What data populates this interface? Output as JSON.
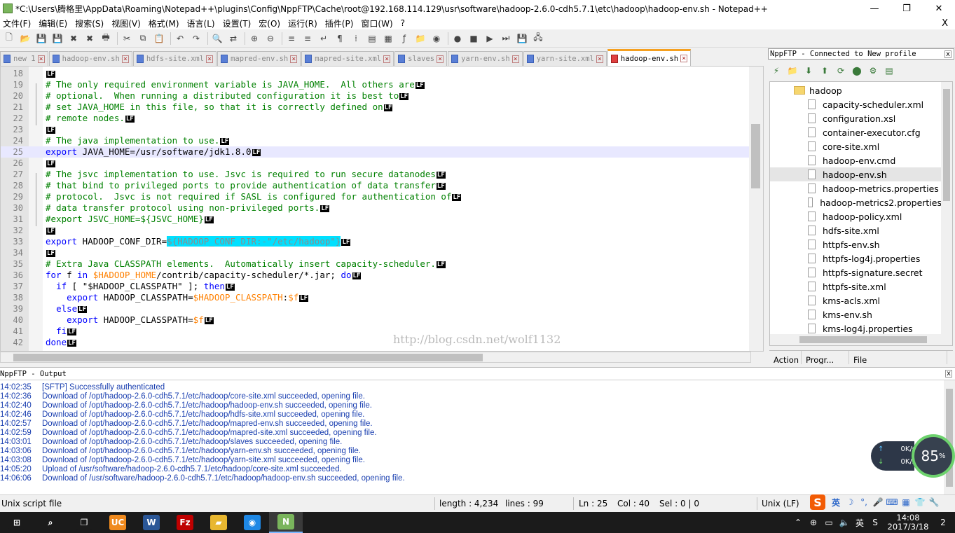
{
  "window": {
    "title": "*C:\\Users\\腾格里\\AppData\\Roaming\\Notepad++\\plugins\\Config\\NppFTP\\Cache\\root@192.168.114.129\\usr\\software\\hadoop-2.6.0-cdh5.7.1\\etc\\hadoop\\hadoop-env.sh - Notepad++",
    "minimize": "—",
    "maximize": "❐",
    "close": "✕"
  },
  "menu": {
    "items": [
      "文件(F)",
      "编辑(E)",
      "搜索(S)",
      "视图(V)",
      "格式(M)",
      "语言(L)",
      "设置(T)",
      "宏(O)",
      "运行(R)",
      "插件(P)",
      "窗口(W)",
      "?"
    ],
    "close": "X"
  },
  "toolbar": {
    "icons": [
      "new-file-icon",
      "open-file-icon",
      "save-icon",
      "save-all-icon",
      "close-icon",
      "close-all-icon",
      "print-icon",
      "cut-icon",
      "copy-icon",
      "paste-icon",
      "undo-icon",
      "redo-icon",
      "find-icon",
      "replace-icon",
      "zoom-in-icon",
      "zoom-out-icon",
      "sync-vertical-icon",
      "sync-horizontal-icon",
      "word-wrap-icon",
      "show-all-chars-icon",
      "indent-guide-icon",
      "udl-icon",
      "doc-map-icon",
      "function-list-icon",
      "folder-workspace-icon",
      "monitoring-icon",
      "record-macro-icon",
      "stop-macro-icon",
      "play-macro-icon",
      "run-macro-multiple-icon",
      "save-macro-icon",
      "nppftp-icon"
    ],
    "glyphs": [
      "🗋",
      "📂",
      "💾",
      "💾",
      "✖",
      "✖",
      "🖶",
      "✂",
      "⧉",
      "📋",
      "↶",
      "↷",
      "🔍",
      "⇄",
      "⊕",
      "⊖",
      "≡",
      "≡",
      "↵",
      "¶",
      "⁞",
      "▤",
      "▦",
      "ƒ",
      "📁",
      "◉",
      "●",
      "■",
      "▶",
      "⏭",
      "💾",
      "🖧"
    ]
  },
  "tabs": [
    {
      "label": "new 1",
      "active": false
    },
    {
      "label": "hadoop-env.sh",
      "active": false
    },
    {
      "label": "hdfs-site.xml",
      "active": false
    },
    {
      "label": "mapred-env.sh",
      "active": false
    },
    {
      "label": "mapred-site.xml",
      "active": false
    },
    {
      "label": "slaves",
      "active": false
    },
    {
      "label": "yarn-env.sh",
      "active": false
    },
    {
      "label": "yarn-site.xml",
      "active": false
    },
    {
      "label": "hadoop-env.sh",
      "active": true
    }
  ],
  "editor": {
    "eol_marker": "LF",
    "current_line": 25,
    "lines": [
      {
        "n": "18",
        "segs": []
      },
      {
        "n": "19",
        "segs": [
          {
            "t": "# The only required environment variable is JAVA_HOME.  All others are",
            "c": "cmt"
          }
        ]
      },
      {
        "n": "20",
        "segs": [
          {
            "t": "# optional.  When running a distributed configuration it is best to",
            "c": "cmt"
          }
        ]
      },
      {
        "n": "21",
        "segs": [
          {
            "t": "# set JAVA_HOME in this file, so that it is correctly defined on",
            "c": "cmt"
          }
        ]
      },
      {
        "n": "22",
        "segs": [
          {
            "t": "# remote nodes.",
            "c": "cmt"
          }
        ]
      },
      {
        "n": "23",
        "segs": []
      },
      {
        "n": "24",
        "segs": [
          {
            "t": "# The java implementation to use.",
            "c": "cmt"
          }
        ]
      },
      {
        "n": "25",
        "segs": [
          {
            "t": "export",
            "c": "kw"
          },
          {
            "t": " JAVA_HOME=/usr/software/jdk1.8.0",
            "c": ""
          }
        ]
      },
      {
        "n": "26",
        "segs": []
      },
      {
        "n": "27",
        "segs": [
          {
            "t": "# The jsvc implementation to use. Jsvc is required to run secure datanodes",
            "c": "cmt"
          }
        ]
      },
      {
        "n": "28",
        "segs": [
          {
            "t": "# that bind to privileged ports to provide authentication of data transfer",
            "c": "cmt"
          }
        ]
      },
      {
        "n": "29",
        "segs": [
          {
            "t": "# protocol.  Jsvc is not required if SASL is configured for authentication of",
            "c": "cmt"
          }
        ]
      },
      {
        "n": "30",
        "segs": [
          {
            "t": "# data transfer protocol using non-privileged ports.",
            "c": "cmt"
          }
        ]
      },
      {
        "n": "31",
        "segs": [
          {
            "t": "#export JSVC_HOME=${JSVC_HOME}",
            "c": "cmt"
          }
        ]
      },
      {
        "n": "32",
        "segs": []
      },
      {
        "n": "33",
        "segs": [
          {
            "t": "export",
            "c": "kw"
          },
          {
            "t": " HADOOP_CONF_DIR=",
            "c": ""
          },
          {
            "t": "${HADOOP_CONF_DIR:-\"/etc/hadoop\"}",
            "c": "hl"
          }
        ]
      },
      {
        "n": "34",
        "segs": []
      },
      {
        "n": "35",
        "segs": [
          {
            "t": "# Extra Java CLASSPATH elements.  Automatically insert capacity-scheduler.",
            "c": "cmt"
          }
        ]
      },
      {
        "n": "36",
        "segs": [
          {
            "t": "for",
            "c": "kw"
          },
          {
            "t": " f ",
            "c": ""
          },
          {
            "t": "in",
            "c": "kw"
          },
          {
            "t": " ",
            "c": ""
          },
          {
            "t": "$HADOOP_HOME",
            "c": "var"
          },
          {
            "t": "/contrib/capacity-scheduler/*.jar; ",
            "c": ""
          },
          {
            "t": "do",
            "c": "kw"
          }
        ]
      },
      {
        "n": "37",
        "segs": [
          {
            "t": "  ",
            "c": ""
          },
          {
            "t": "if",
            "c": "kw"
          },
          {
            "t": " [ \"$HADOOP_CLASSPATH\" ]; ",
            "c": ""
          },
          {
            "t": "then",
            "c": "kw"
          }
        ]
      },
      {
        "n": "38",
        "segs": [
          {
            "t": "    ",
            "c": ""
          },
          {
            "t": "export",
            "c": "kw"
          },
          {
            "t": " HADOOP_CLASSPATH=",
            "c": ""
          },
          {
            "t": "$HADOOP_CLASSPATH",
            "c": "var"
          },
          {
            "t": ":",
            "c": ""
          },
          {
            "t": "$f",
            "c": "var"
          }
        ]
      },
      {
        "n": "39",
        "segs": [
          {
            "t": "  ",
            "c": ""
          },
          {
            "t": "else",
            "c": "kw"
          }
        ]
      },
      {
        "n": "40",
        "segs": [
          {
            "t": "    ",
            "c": ""
          },
          {
            "t": "export",
            "c": "kw"
          },
          {
            "t": " HADOOP_CLASSPATH=",
            "c": ""
          },
          {
            "t": "$f",
            "c": "var"
          }
        ]
      },
      {
        "n": "41",
        "segs": [
          {
            "t": "  ",
            "c": ""
          },
          {
            "t": "fi",
            "c": "kw"
          }
        ]
      },
      {
        "n": "42",
        "segs": [
          {
            "t": "done",
            "c": "kw"
          }
        ]
      }
    ],
    "watermark": "http://blog.csdn.net/wolf1132"
  },
  "nppftp": {
    "title": "NppFTP - Connected to New profile",
    "close": "x",
    "toolbar_icons": [
      "connect-icon",
      "open-dir-icon",
      "download-icon",
      "upload-icon",
      "refresh-icon",
      "abort-icon",
      "settings-icon",
      "message-window-icon"
    ],
    "toolbar_glyphs": [
      "⚡",
      "📁",
      "⬇",
      "⬆",
      "⟳",
      "⬤",
      "⚙",
      "▤"
    ],
    "tree": [
      {
        "name": "hadoop",
        "type": "folder"
      },
      {
        "name": "capacity-scheduler.xml",
        "type": "file"
      },
      {
        "name": "configuration.xsl",
        "type": "file"
      },
      {
        "name": "container-executor.cfg",
        "type": "file"
      },
      {
        "name": "core-site.xml",
        "type": "file"
      },
      {
        "name": "hadoop-env.cmd",
        "type": "file"
      },
      {
        "name": "hadoop-env.sh",
        "type": "file",
        "selected": true
      },
      {
        "name": "hadoop-metrics.properties",
        "type": "file"
      },
      {
        "name": "hadoop-metrics2.properties",
        "type": "file"
      },
      {
        "name": "hadoop-policy.xml",
        "type": "file"
      },
      {
        "name": "hdfs-site.xml",
        "type": "file"
      },
      {
        "name": "httpfs-env.sh",
        "type": "file"
      },
      {
        "name": "httpfs-log4j.properties",
        "type": "file"
      },
      {
        "name": "httpfs-signature.secret",
        "type": "file"
      },
      {
        "name": "httpfs-site.xml",
        "type": "file"
      },
      {
        "name": "kms-acls.xml",
        "type": "file"
      },
      {
        "name": "kms-env.sh",
        "type": "file"
      },
      {
        "name": "kms-log4j.properties",
        "type": "file"
      }
    ],
    "columns": [
      "Action",
      "Progr...",
      "File"
    ]
  },
  "output": {
    "title": "NppFTP - Output",
    "close": "x",
    "lines": [
      {
        "time": "14:02:35",
        "msg": "[SFTP] Successfully authenticated"
      },
      {
        "time": "14:02:36",
        "msg": "Download of /opt/hadoop-2.6.0-cdh5.7.1/etc/hadoop/core-site.xml succeeded, opening file."
      },
      {
        "time": "14:02:40",
        "msg": "Download of /opt/hadoop-2.6.0-cdh5.7.1/etc/hadoop/hadoop-env.sh succeeded, opening file."
      },
      {
        "time": "14:02:46",
        "msg": "Download of /opt/hadoop-2.6.0-cdh5.7.1/etc/hadoop/hdfs-site.xml succeeded, opening file."
      },
      {
        "time": "14:02:57",
        "msg": "Download of /opt/hadoop-2.6.0-cdh5.7.1/etc/hadoop/mapred-env.sh succeeded, opening file."
      },
      {
        "time": "14:02:59",
        "msg": "Download of /opt/hadoop-2.6.0-cdh5.7.1/etc/hadoop/mapred-site.xml succeeded, opening file."
      },
      {
        "time": "14:03:01",
        "msg": "Download of /opt/hadoop-2.6.0-cdh5.7.1/etc/hadoop/slaves succeeded, opening file."
      },
      {
        "time": "14:03:06",
        "msg": "Download of /opt/hadoop-2.6.0-cdh5.7.1/etc/hadoop/yarn-env.sh succeeded, opening file."
      },
      {
        "time": "14:03:08",
        "msg": "Download of /opt/hadoop-2.6.0-cdh5.7.1/etc/hadoop/yarn-site.xml succeeded, opening file."
      },
      {
        "time": "14:05:20",
        "msg": "Upload of /usr/software/hadoop-2.6.0-cdh5.7.1/etc/hadoop/core-site.xml succeeded."
      },
      {
        "time": "14:06:06",
        "msg": "Download of /usr/software/hadoop-2.6.0-cdh5.7.1/etc/hadoop/hadoop-env.sh succeeded, opening file."
      }
    ]
  },
  "net_widget": {
    "up_arrow": "↑",
    "down_arrow": "↓",
    "up": "0K/s",
    "down": "0K/s",
    "percent": "85",
    "percent_unit": "%"
  },
  "statusbar": {
    "filetype": "Unix script file",
    "length": "length : 4,234",
    "lines": "lines : 99",
    "ln": "Ln : 25",
    "col": "Col : 40",
    "sel": "Sel : 0 | 0",
    "eol": "Unix (LF)"
  },
  "ime": {
    "logo": "S",
    "mode": "英",
    "icons": [
      "moon-icon",
      "punctuation-icon",
      "microphone-icon",
      "keyboard-icon",
      "skin-icon",
      "shirt-icon",
      "wrench-icon"
    ],
    "glyphs": [
      "☽",
      "°,",
      "🎤",
      "⌨",
      "▦",
      "👕",
      "🔧"
    ]
  },
  "taskbar": {
    "apps": [
      {
        "name": "start-icon",
        "glyph": "⊞",
        "color": "#1b1b1b"
      },
      {
        "name": "search-icon",
        "glyph": "⌕",
        "color": "#1b1b1b"
      },
      {
        "name": "task-view-icon",
        "glyph": "❐",
        "color": "#1b1b1b"
      },
      {
        "name": "uc-browser-icon",
        "glyph": "UC",
        "color": "#f08a1e"
      },
      {
        "name": "word-icon",
        "glyph": "W",
        "color": "#2b5797"
      },
      {
        "name": "filezilla-icon",
        "glyph": "Fz",
        "color": "#bf0000"
      },
      {
        "name": "file-explorer-icon",
        "glyph": "▰",
        "color": "#e8b730"
      },
      {
        "name": "qq-browser-icon",
        "glyph": "◉",
        "color": "#1e88e5"
      },
      {
        "name": "notepadpp-icon",
        "glyph": "N",
        "color": "#7ab55c"
      }
    ],
    "tray_glyphs": [
      "⌃",
      "⊕",
      "▭",
      "🔈",
      "英",
      "S"
    ],
    "tray_names": [
      "show-hidden-icons-icon",
      "network-status-icon",
      "battery-icon",
      "volume-icon",
      "ime-mode-icon",
      "sogou-tray-icon"
    ],
    "time": "14:08",
    "date": "2017/3/18",
    "notifications": "2"
  }
}
